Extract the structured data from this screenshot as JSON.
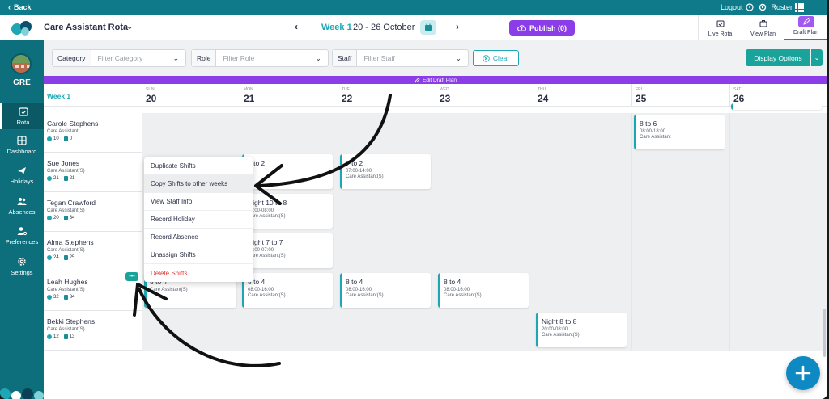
{
  "topbar": {
    "back_label": "Back",
    "logout_label": "Logout",
    "roster_label": "Roster"
  },
  "header": {
    "app_title": "Care Assistant Rota",
    "week_label": "Week 1",
    "week_range": "20 - 26 October",
    "publish_label": "Publish (0)"
  },
  "view_tabs": [
    {
      "label": "Live Rota",
      "icon": "live-rota-icon"
    },
    {
      "label": "View Plan",
      "icon": "view-plan-icon"
    },
    {
      "label": "Draft Plan",
      "icon": "pencil-icon",
      "active": true
    }
  ],
  "sidebar": {
    "org": "GRE",
    "items": [
      {
        "label": "Rota",
        "icon": "calendar-icon",
        "active": true
      },
      {
        "label": "Dashboard",
        "icon": "grid-icon"
      },
      {
        "label": "Holidays",
        "icon": "plane-icon"
      },
      {
        "label": "Absences",
        "icon": "people-icon"
      },
      {
        "label": "Preferences",
        "icon": "user-gear-icon"
      },
      {
        "label": "Settings",
        "icon": "gear-icon"
      }
    ]
  },
  "filters": {
    "category": {
      "label": "Category",
      "placeholder": "Filter Category"
    },
    "role": {
      "label": "Role",
      "placeholder": "Filter Role"
    },
    "staff": {
      "label": "Staff",
      "placeholder": "Filter Staff"
    },
    "clear_label": "Clear",
    "display_label": "Display Options"
  },
  "banner": {
    "label": "Edit Draft Plan"
  },
  "grid": {
    "week_label": "Week 1",
    "days": [
      {
        "name": "SUN",
        "num": "20"
      },
      {
        "name": "MON",
        "num": "21"
      },
      {
        "name": "TUE",
        "num": "22"
      },
      {
        "name": "WED",
        "num": "23"
      },
      {
        "name": "THU",
        "num": "24"
      },
      {
        "name": "FRI",
        "num": "25"
      },
      {
        "name": "SAT",
        "num": "26"
      }
    ],
    "staff": [
      {
        "name": "Carole Stephens",
        "role": "Care Assistant",
        "hours": "10",
        "shifts": "0"
      },
      {
        "name": "Sue Jones",
        "role": "Care Assistant(S)",
        "hours": "21",
        "shifts": "21"
      },
      {
        "name": "Tegan Crawford",
        "role": "Care Assistant(S)",
        "hours": "20",
        "shifts": "34"
      },
      {
        "name": "Alma Stephens",
        "role": "Care Assistant(S)",
        "hours": "24",
        "shifts": "25"
      },
      {
        "name": "Leah Hughes",
        "role": "Care Assistant(S)",
        "hours": "32",
        "shifts": "34"
      },
      {
        "name": "Bekki Stephens",
        "role": "Care Assistant(S)",
        "hours": "12",
        "shifts": "13"
      }
    ],
    "shifts": [
      {
        "title": "8 to 6",
        "time": "08:00-18:00",
        "role": "Care Assistant"
      },
      {
        "title": "8 to 2",
        "time": "",
        "role": ""
      },
      {
        "title": "7 to 2",
        "time": "07:00-14:00",
        "role": "Care Assistant(S)"
      },
      {
        "title": "Night 10 to 8",
        "time": "22:00-08:00",
        "role": "Care Assistant(S)"
      },
      {
        "title": "Night 7 to 7",
        "time": "19:00-07:00",
        "role": "Care Assistant(S)"
      },
      {
        "title": "8 to 4",
        "time": "",
        "role": "Care Assistant(S)"
      },
      {
        "title": "8 to 4",
        "time": "08:00-16:00",
        "role": "Care Assistant(S)"
      },
      {
        "title": "8 to 4",
        "time": "08:00-16:00",
        "role": "Care Assistant(S)"
      },
      {
        "title": "8 to 4",
        "time": "08:00-16:00",
        "role": "Care Assistant(S)"
      },
      {
        "title": "Night 8 to 8",
        "time": "20:00-08:00",
        "role": "Care Assistant(S)"
      }
    ]
  },
  "context_menu": {
    "items": [
      "Duplicate Shifts",
      "Copy Shifts to other weeks",
      "View Staff Info",
      "Record Holiday",
      "Record Absence",
      "Unassign Shifts",
      "Delete Shifts"
    ]
  },
  "colors": {
    "teal": "#1fa6b4",
    "sidebar": "#0d6e7c",
    "purple": "#8b3ee8",
    "danger": "#e03535",
    "fab": "#0e89c4"
  }
}
